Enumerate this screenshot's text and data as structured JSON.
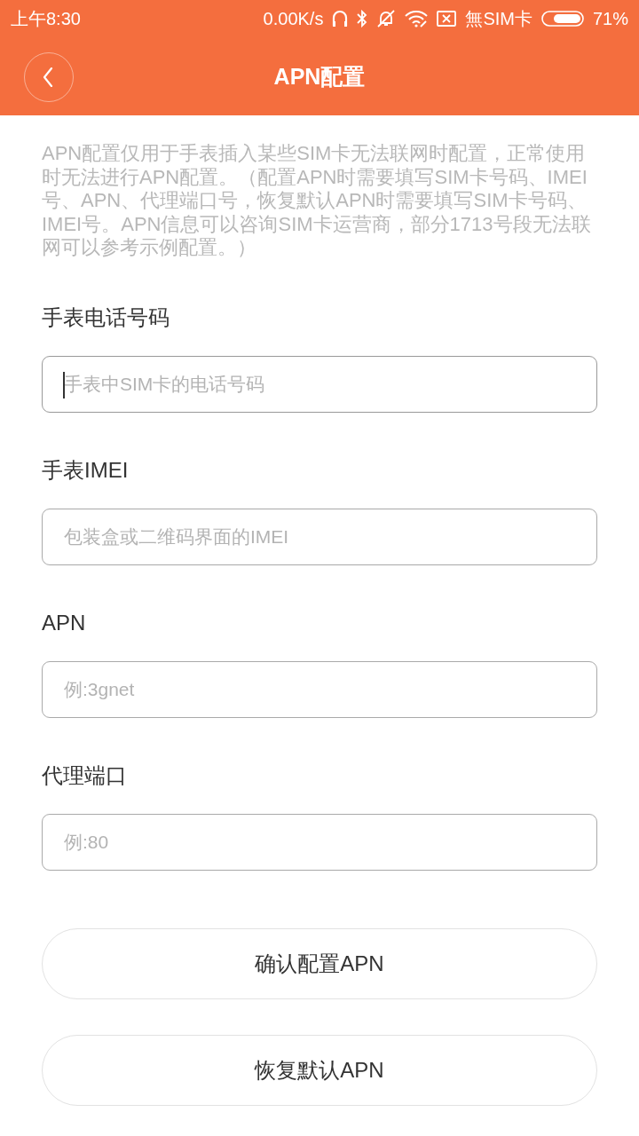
{
  "status_bar": {
    "time": "上午8:30",
    "net_speed": "0.00K/s",
    "sim_status": "無SIM卡",
    "battery": "71%"
  },
  "header": {
    "title": "APN配置"
  },
  "description": "APN配置仅用于手表插入某些SIM卡无法联网时配置，正常使用时无法进行APN配置。（配置APN时需要填写SIM卡号码、IMEI号、APN、代理端口号，恢复默认APN时需要填写SIM卡号码、IMEI号。APN信息可以咨询SIM卡运营商，部分1713号段无法联网可以参考示例配置。）",
  "fields": [
    {
      "label": "手表电话号码",
      "placeholder": "手表中SIM卡的电话号码",
      "focused": true
    },
    {
      "label": "手表IMEI",
      "placeholder": "包装盒或二维码界面的IMEI",
      "focused": false
    },
    {
      "label": "APN",
      "placeholder": "例:3gnet",
      "focused": false
    },
    {
      "label": "代理端口",
      "placeholder": "例:80",
      "focused": false
    }
  ],
  "buttons": [
    "确认配置APN",
    "恢复默认APN"
  ]
}
